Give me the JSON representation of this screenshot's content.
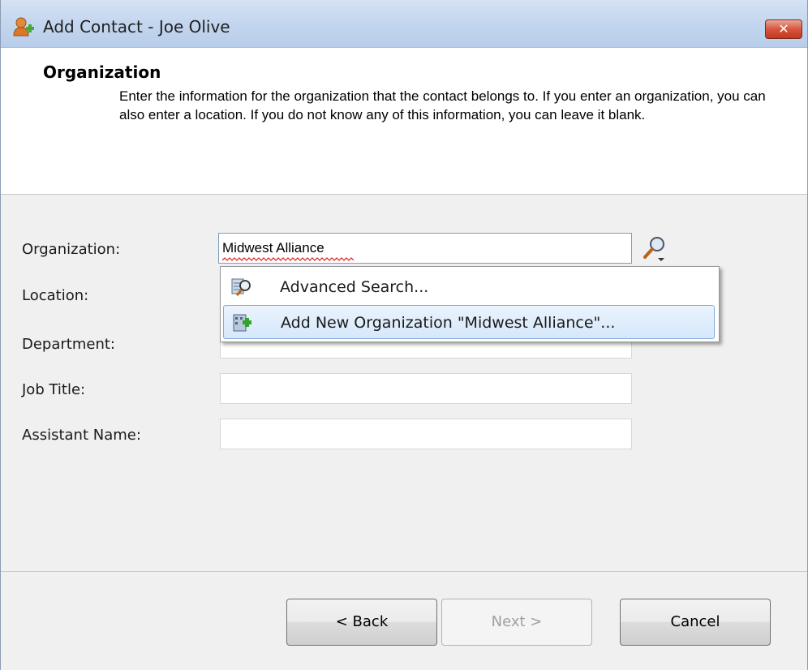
{
  "window": {
    "title": "Add Contact - Joe Olive",
    "close_label": "✕"
  },
  "header": {
    "title": "Organization",
    "description": "Enter the information for the organization that the contact belongs to.  If you enter an organization, you can also enter a location.  If you do not know any of this information, you can leave it blank."
  },
  "form": {
    "organization": {
      "label": "Organization:",
      "value": "Midwest Alliance"
    },
    "location": {
      "label": "Location:",
      "value": ""
    },
    "department": {
      "label": "Department:",
      "value": ""
    },
    "job_title": {
      "label": "Job Title:",
      "value": ""
    },
    "assistant_name": {
      "label": "Assistant Name:",
      "value": ""
    }
  },
  "dropdown": {
    "items": [
      {
        "label": "Advanced Search...",
        "icon": "advanced-search-icon",
        "highlighted": false
      },
      {
        "label": "Add New Organization \"Midwest Alliance\"...",
        "icon": "add-organization-icon",
        "highlighted": true
      }
    ]
  },
  "buttons": {
    "back": "< Back",
    "next": "Next >",
    "cancel": "Cancel",
    "next_enabled": false
  },
  "colors": {
    "titlebar": "#c5d7ef",
    "close": "#d6553f",
    "highlight": "#d6e8fb",
    "body_bg": "#f0f0f0"
  }
}
